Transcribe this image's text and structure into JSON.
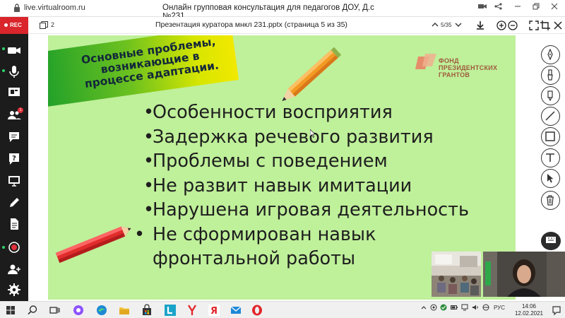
{
  "browser": {
    "url": "live.virtualroom.ru",
    "title": "Онлайн групповая консультация для педагогов ДОУ, Д.с №231"
  },
  "appbar": {
    "rec_label": "REC",
    "pages_count": "2",
    "document_title": "Презентация куратора мнкл 231.pptx (страница 5 из 35)",
    "page_indicator": "5/35"
  },
  "sidebar": {
    "participants_badge": "1"
  },
  "slide": {
    "banner_text": "Основные проблемы, возникающие в процессе адаптации.",
    "logo_text": [
      "ФОНД",
      "ПРЕЗИДЕНТСКИХ",
      "ГРАНТОВ"
    ],
    "bullets": [
      "Особенности восприятия",
      "Задержка речевого развития",
      "Проблемы с поведением",
      "Не развит навык имитации",
      "Нарушена игровая деятельность",
      "Не сформирован навык фронтальной работы"
    ],
    "bullet_symbol": "•",
    "background_color": "#bff09a"
  },
  "taskbar": {
    "lang": "РУС",
    "time": "14:06",
    "date": "12.02.2021"
  },
  "colors": {
    "rec": "#d9252b",
    "sidebar": "#1c1c1c",
    "slide_bg": "#bff09a",
    "status_green": "#2fd16c"
  }
}
